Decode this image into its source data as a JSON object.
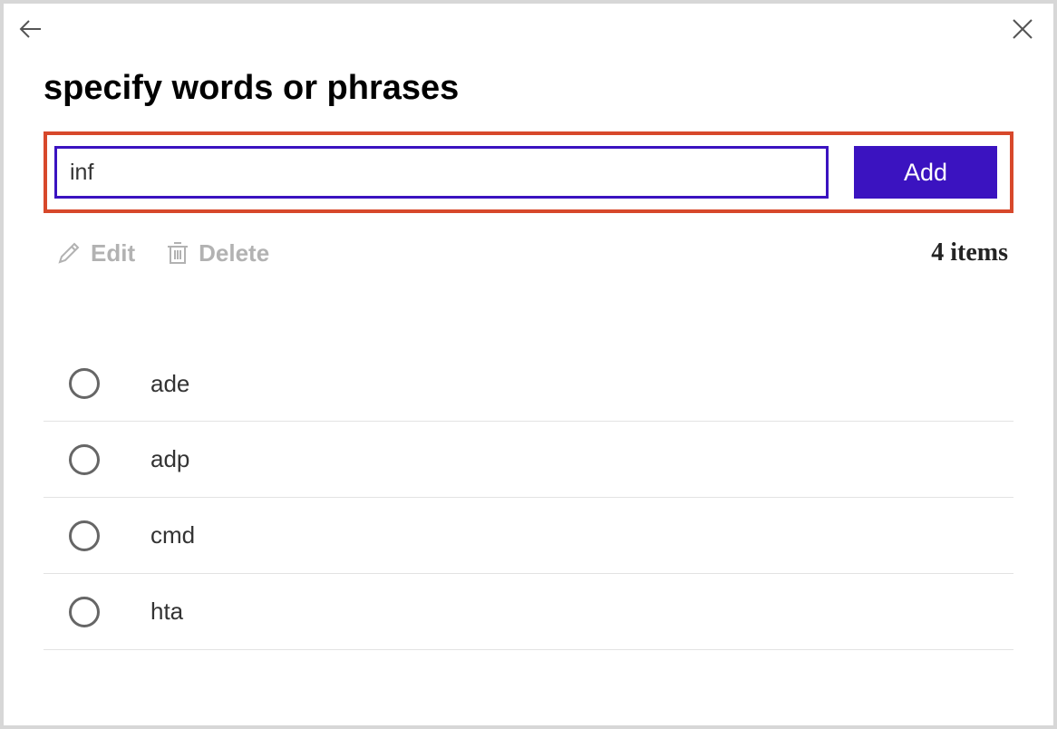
{
  "title": "specify words or phrases",
  "input": {
    "value": "inf"
  },
  "add_label": "Add",
  "toolbar": {
    "edit_label": "Edit",
    "delete_label": "Delete"
  },
  "item_count_label": "4 items",
  "items": [
    {
      "label": "ade"
    },
    {
      "label": "adp"
    },
    {
      "label": "cmd"
    },
    {
      "label": "hta"
    }
  ]
}
